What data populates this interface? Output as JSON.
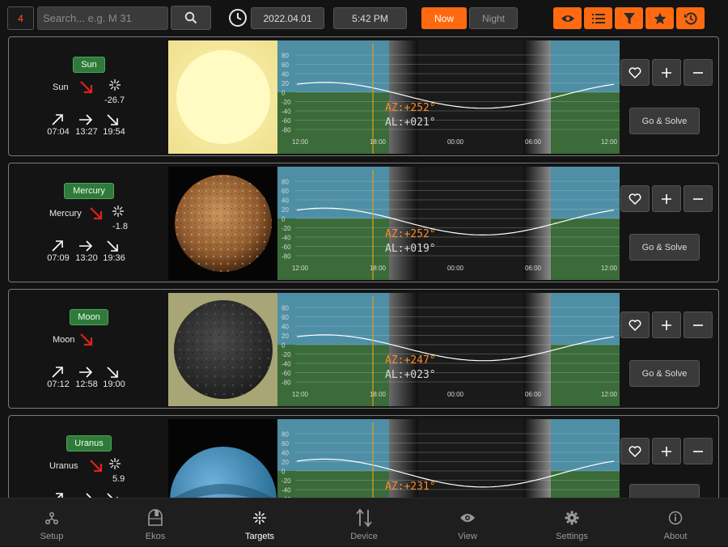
{
  "toolbar": {
    "count": "4",
    "search_placeholder": "Search... e.g. M 31",
    "date": "2022.04.01",
    "time": "5:42 PM",
    "now_label": "Now",
    "night_label": "Night",
    "accent": "#ff6a10"
  },
  "chart_axis": {
    "y_ticks": [
      "80",
      "60",
      "40",
      "20",
      "0",
      "-20",
      "-40",
      "-60",
      "-80"
    ],
    "x_ticks": [
      "12:00",
      "18:00",
      "00:00",
      "06:00",
      "12:00"
    ]
  },
  "targets": [
    {
      "name": "Sun",
      "label": "Sun",
      "magnitude": "-26.7",
      "rise": "07:04",
      "transit": "13:27",
      "set": "19:54",
      "az": "AZ:+252°",
      "al": "AL:+021°",
      "go_label": "Go & Solve",
      "thumb": "sun"
    },
    {
      "name": "Mercury",
      "label": "Mercury",
      "magnitude": "-1.8",
      "rise": "07:09",
      "transit": "13:20",
      "set": "19:36",
      "az": "AZ:+252°",
      "al": "AL:+019°",
      "go_label": "Go & Solve",
      "thumb": "mercury"
    },
    {
      "name": "Moon",
      "label": "Moon",
      "magnitude": "",
      "rise": "07:12",
      "transit": "12:58",
      "set": "19:00",
      "az": "AZ:+247°",
      "al": "AL:+023°",
      "go_label": "Go & Solve",
      "thumb": "moon"
    },
    {
      "name": "Uranus",
      "label": "Uranus",
      "magnitude": "5.9",
      "rise": "",
      "transit": "",
      "set": "",
      "az": "AZ:+231°",
      "al": "",
      "go_label": "",
      "thumb": "uranus"
    }
  ],
  "tabs": [
    {
      "label": "Setup",
      "icon": "setup-icon"
    },
    {
      "label": "Ekos",
      "icon": "ekos-icon"
    },
    {
      "label": "Targets",
      "icon": "targets-icon",
      "active": true
    },
    {
      "label": "Device",
      "icon": "device-icon"
    },
    {
      "label": "View",
      "icon": "view-icon"
    },
    {
      "label": "Settings",
      "icon": "settings-icon"
    },
    {
      "label": "About",
      "icon": "about-icon"
    }
  ]
}
